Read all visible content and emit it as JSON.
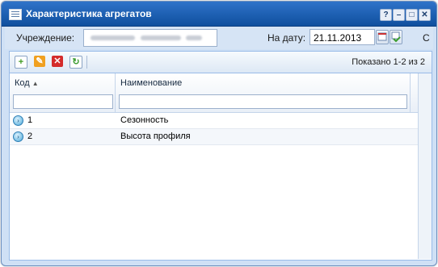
{
  "window": {
    "title": "Характеристика агрегатов",
    "controls": [
      "?",
      "–",
      "□",
      "✕"
    ]
  },
  "filters": {
    "institution_label": "Учреждение:",
    "date_label": "На дату:",
    "date_value": "21.11.2013",
    "overflow_text": "С"
  },
  "toolbar": {
    "add_icon": "add-icon",
    "edit_icon": "edit-icon",
    "delete_icon": "delete-icon",
    "refresh_icon": "refresh-icon",
    "shown_text": "Показано 1-2 из 2"
  },
  "grid": {
    "columns": [
      "Код",
      "Наименование"
    ],
    "rows": [
      {
        "code": "1",
        "name": "Сезонность"
      },
      {
        "code": "2",
        "name": "Высота профиля"
      }
    ]
  },
  "colors": {
    "titlebar": "#1f63b8",
    "add": "#3d9a1f",
    "edit": "#f0a020",
    "delete": "#d42b2b",
    "refresh": "#3a9b2e"
  }
}
